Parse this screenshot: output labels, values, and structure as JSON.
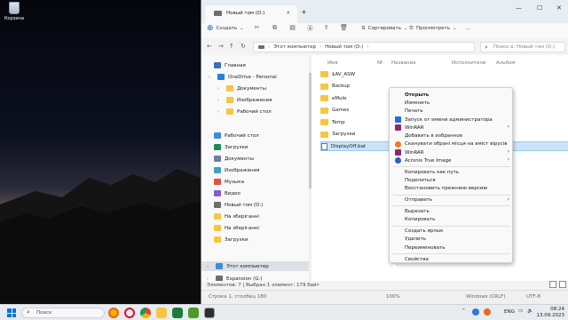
{
  "desktop": {
    "recycle_label": "Корзина"
  },
  "window": {
    "tab_title": "Новый том (D:)",
    "toolbar": {
      "create": "Создать",
      "sort": "Сортировать",
      "view": "Просмотреть",
      "more": "..."
    },
    "breadcrumb": [
      "Этот компьютер",
      "Новый том (D:)"
    ],
    "search_placeholder": "Поиск в: Новый том (D:)",
    "nav": [
      {
        "label": "Главная",
        "icon": "home-icon"
      },
      {
        "label": "OneDrive - Personal",
        "icon": "cloud-icon"
      },
      {
        "label": "Документы",
        "icon": "folder-icon"
      },
      {
        "label": "Изображения",
        "icon": "folder-icon"
      },
      {
        "label": "Рабочий стол",
        "icon": "folder-icon"
      },
      {
        "label": "Рабочий стол",
        "icon": "desktop-icon"
      },
      {
        "label": "Загрузки",
        "icon": "download-icon"
      },
      {
        "label": "Документы",
        "icon": "documents-icon"
      },
      {
        "label": "Изображения",
        "icon": "pictures-icon"
      },
      {
        "label": "Музыка",
        "icon": "music-icon"
      },
      {
        "label": "Видео",
        "icon": "video-icon"
      },
      {
        "label": "Новый том (D:)",
        "icon": "drive-icon"
      },
      {
        "label": "На зберіганні",
        "icon": "folder-icon"
      },
      {
        "label": "На зберіганні",
        "icon": "folder-icon"
      },
      {
        "label": "Загрузки",
        "icon": "folder-icon"
      },
      {
        "label": "Этот компьютер",
        "icon": "computer-icon"
      },
      {
        "label": "Expansion (G:)",
        "icon": "drive-icon"
      }
    ],
    "columns": {
      "name": "Имя",
      "nf": "Nf",
      "title": "Название",
      "artists": "Исполнители",
      "album": "Альбом"
    },
    "files": [
      {
        "name": "$AV_ASW",
        "type": "folder"
      },
      {
        "name": "Backup",
        "type": "folder"
      },
      {
        "name": "eMule",
        "type": "folder"
      },
      {
        "name": "Games",
        "type": "folder"
      },
      {
        "name": "Temp",
        "type": "folder"
      },
      {
        "name": "Загрузки",
        "type": "folder"
      },
      {
        "name": "DisplayOff.bat",
        "type": "bat"
      }
    ],
    "status": "Элементов: 7   |   Выбран 1 элемент: 179 байт",
    "editor_bar": {
      "position": "Строка 1, столбец 180",
      "zoom": "100%",
      "eol": "Windows (CRLF)",
      "encoding": "UTF-8"
    }
  },
  "context_menu": [
    {
      "label": "Открыть",
      "bold": true
    },
    {
      "label": "Изменить"
    },
    {
      "label": "Печать"
    },
    {
      "label": "Запуск от имени администратора",
      "icon": "shield-icon",
      "color": "#2b6cd4"
    },
    {
      "label": "WinRAR",
      "icon": "winrar-icon",
      "color": "#8b2a6b",
      "submenu": true
    },
    {
      "label": "Добавить в избранное"
    },
    {
      "label": "Сканувати обрані місця на вміст вірусів",
      "icon": "avast-icon",
      "color": "#f07c1c"
    },
    {
      "label": "WinRAR",
      "icon": "winrar-icon",
      "color": "#8b2a6b",
      "submenu": true
    },
    {
      "label": "Acronis True Image",
      "icon": "acronis-icon",
      "color": "#2a60c4",
      "submenu": true
    },
    {
      "sep": true
    },
    {
      "label": "Копировать как путь"
    },
    {
      "label": "Поделиться"
    },
    {
      "label": "Восстановить прежнюю версию"
    },
    {
      "sep": true
    },
    {
      "label": "Отправить",
      "submenu": true
    },
    {
      "sep": true
    },
    {
      "label": "Вырезать"
    },
    {
      "label": "Копировать"
    },
    {
      "sep": true
    },
    {
      "label": "Создать ярлык"
    },
    {
      "label": "Удалить"
    },
    {
      "label": "Переименовать"
    },
    {
      "sep": true
    },
    {
      "label": "Свойства"
    }
  ],
  "taskbar": {
    "search": "Поиск",
    "lang": "ENG",
    "time": "08:24",
    "date": "13.09.2023"
  }
}
